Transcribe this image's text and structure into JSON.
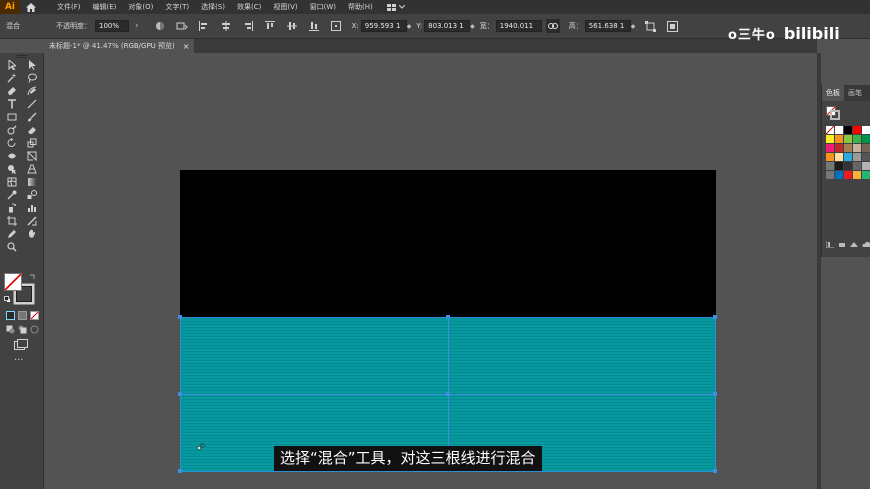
{
  "app": {
    "logo": "Ai"
  },
  "menu": [
    "文件(F)",
    "编辑(E)",
    "对象(O)",
    "文字(T)",
    "选择(S)",
    "效果(C)",
    "视图(V)",
    "窗口(W)",
    "帮助(H)"
  ],
  "control": {
    "selection_label": "混合",
    "opacity_label": "不透明度：",
    "opacity_value": "100%",
    "opacity_arrow": "›",
    "x_label": "X:",
    "x_value": "959.593 1",
    "y_label": "Y:",
    "y_value": "803.013 1",
    "w_label": "宽：",
    "w_value": "1940.011",
    "h_label": "高：",
    "h_value": "561.638 1"
  },
  "document": {
    "tab_title": "未标题-1* @ 41.47% (RGB/GPU 预览)",
    "close": "×"
  },
  "right_panel": {
    "tabs": [
      "色板",
      "画笔"
    ]
  },
  "subtitle": "选择“混合”工具，对这三根线进行混合",
  "watermark": {
    "text": "o三牛o",
    "logo": "bilibili"
  },
  "toolbar": {
    "more": "···"
  },
  "colors": {
    "artboard_top": "#000000",
    "blend_fill": "#069aa0",
    "selection": "#3e8fe0",
    "ai_orange": "#ff9a00"
  },
  "icons": {
    "tools": [
      "selection-tool-icon",
      "direct-selection-tool-icon",
      "magic-wand-icon",
      "lasso-icon",
      "pen-tool-icon",
      "curvature-tool-icon",
      "type-tool-icon",
      "line-tool-icon",
      "rectangle-tool-icon",
      "paintbrush-icon",
      "shaper-icon",
      "eraser-icon",
      "rotate-icon",
      "scale-icon",
      "width-tool-icon",
      "free-transform-icon",
      "shape-builder-icon",
      "perspective-grid-icon",
      "mesh-tool-icon",
      "gradient-tool-icon",
      "eyedropper-icon",
      "blend-tool-icon",
      "symbol-sprayer-icon",
      "column-graph-icon",
      "artboard-tool-icon",
      "slice-tool-icon",
      "hand-tool-icon",
      "zoom-tool-icon"
    ]
  }
}
